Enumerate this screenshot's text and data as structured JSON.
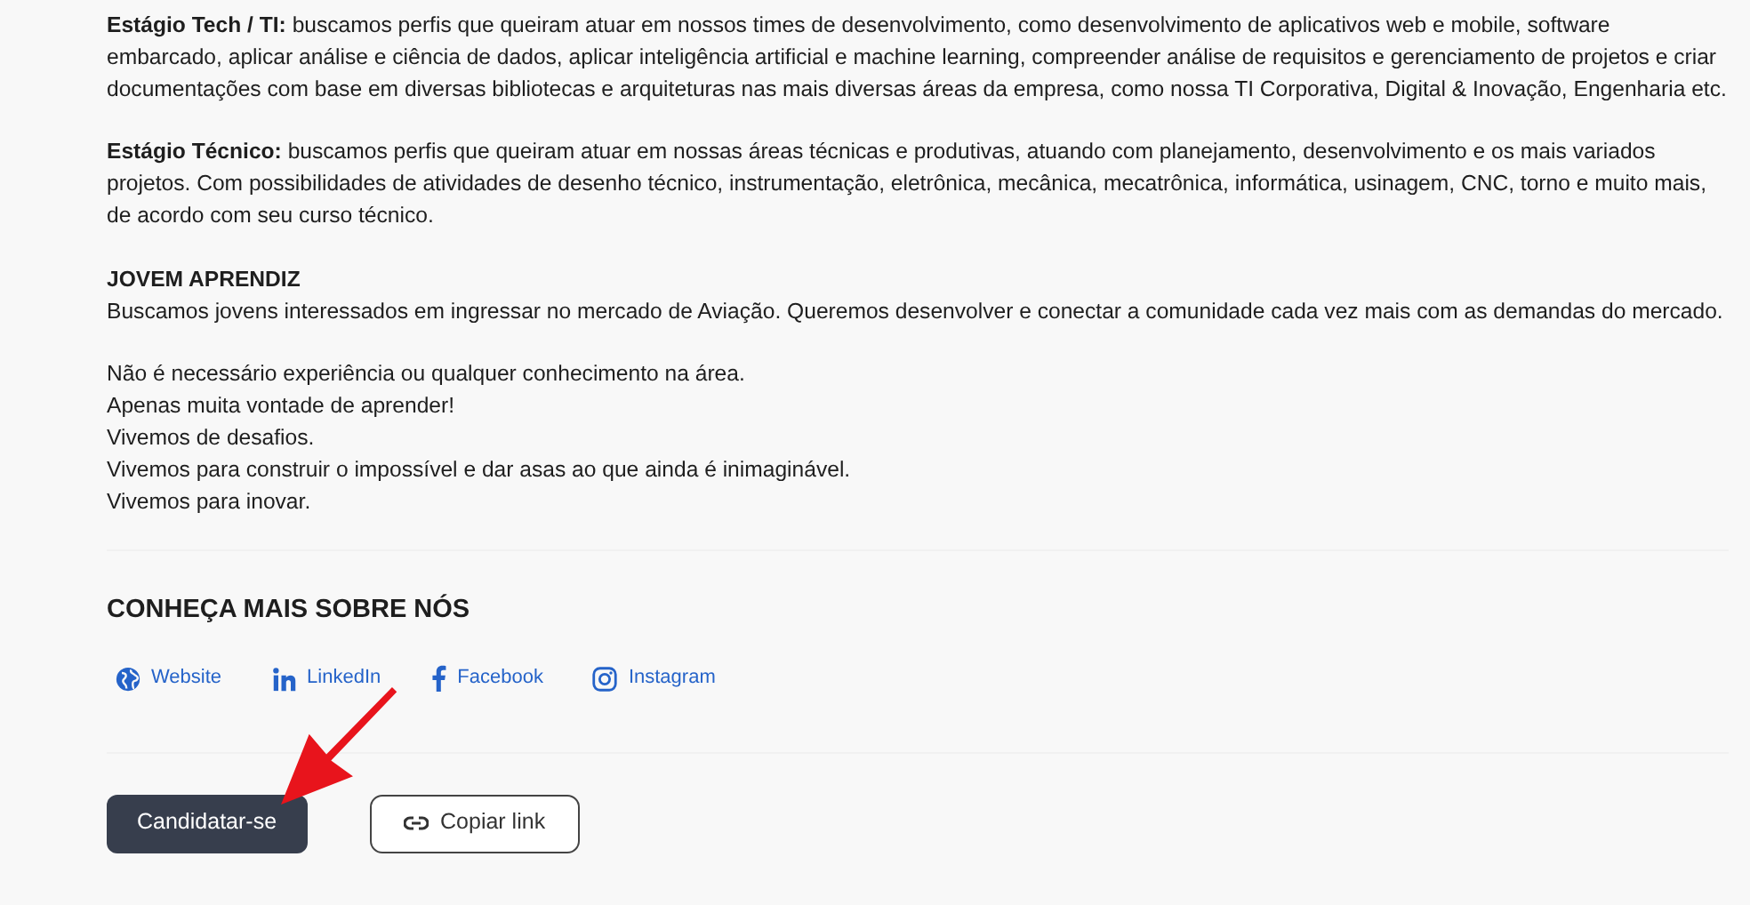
{
  "blocks": [
    {
      "items": [
        {
          "kind": "text",
          "text": "**Estágio Tech / TI:** buscamos perfis que queiram atuar em nossos times de desenvolvimento, como desenvolvimento de aplicativos web e mobile, software embarcado, aplicar análise e ciência de dados, aplicar inteligência artificial e machine learning, compreender análise de requisitos e gerenciamento de projetos e criar documentações com base em diversas bibliotecas e arquiteturas nas mais diversas áreas da empresa, como nossa TI Corporativa, Digital & Inovação, Engenharia etc."
        }
      ]
    },
    {
      "items": [
        {
          "kind": "text",
          "text": "**Estágio Técnico:** buscamos perfis que queiram atuar em nossas áreas técnicas e produtivas, atuando com planejamento, desenvolvimento e os mais variados projetos. Com possibilidades de atividades de desenho técnico, instrumentação, eletrônica, mecânica, mecatrônica, informática, usinagem, CNC, torno e muito mais, de acordo com seu curso técnico."
        }
      ]
    },
    {
      "items": [
        {
          "kind": "heading",
          "text": "JOVEM APRENDIZ"
        },
        {
          "kind": "text",
          "text": "Buscamos jovens interessados em ingressar no mercado de Aviação. Queremos desenvolver e conectar a comunidade cada vez mais com as demandas do mercado."
        }
      ]
    },
    {
      "items": [
        {
          "kind": "text",
          "text": "Não é necessário experiência ou qualquer conhecimento na área."
        },
        {
          "kind": "text",
          "text": "Apenas muita vontade de aprender!"
        },
        {
          "kind": "text",
          "text": "Vivemos de desafios."
        },
        {
          "kind": "text",
          "text": "Vivemos para construir o impossível e dar asas ao que ainda é inimaginável."
        },
        {
          "kind": "text",
          "text": "Vivemos para inovar."
        }
      ]
    }
  ],
  "about": {
    "title": "CONHEÇA MAIS SOBRE NÓS",
    "links": [
      {
        "kind": "globe",
        "label": "Website"
      },
      {
        "kind": "linkedin",
        "label": "LinkedIn"
      },
      {
        "kind": "facebook",
        "label": "Facebook"
      },
      {
        "kind": "instagram",
        "label": "Instagram"
      }
    ]
  },
  "actions": {
    "apply": "Candidatar-se",
    "copy": "Copiar link"
  }
}
